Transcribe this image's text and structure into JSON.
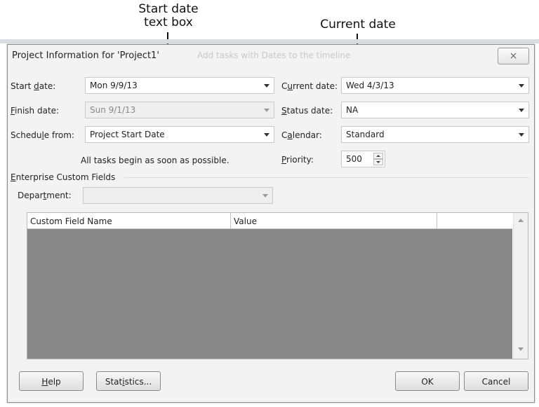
{
  "callouts": {
    "start_date_line1": "Start date",
    "start_date_line2": "text box",
    "current_date": "Current date"
  },
  "dialog": {
    "title": "Project Information for 'Project1'",
    "background_hint": "Add tasks with Dates to the timeline",
    "close_glyph": "⨯"
  },
  "fields": {
    "start_date": {
      "label": "Start date:",
      "value": "Mon 9/9/13"
    },
    "finish_date": {
      "label": "Finish date:",
      "value": "Sun 9/1/13"
    },
    "schedule_from": {
      "label": "Schedule from:",
      "value": "Project Start Date"
    },
    "schedule_note": "All tasks begin as soon as possible.",
    "current_date": {
      "label": "Current date:",
      "value": "Wed 4/3/13"
    },
    "status_date": {
      "label": "Status date:",
      "value": "NA"
    },
    "calendar": {
      "label": "Calendar:",
      "value": "Standard"
    },
    "priority": {
      "label": "Priority:",
      "value": "500"
    }
  },
  "enterprise": {
    "section_label": "Enterprise Custom Fields",
    "department_label": "Department:",
    "department_value": ""
  },
  "grid": {
    "columns": [
      "Custom Field Name",
      "Value",
      ""
    ],
    "rows": []
  },
  "buttons": {
    "help": "Help",
    "statistics": "Statistics...",
    "ok": "OK",
    "cancel": "Cancel"
  },
  "colors": {
    "grid_body": "#878787",
    "dialog_bg": "#f3f3f3"
  }
}
